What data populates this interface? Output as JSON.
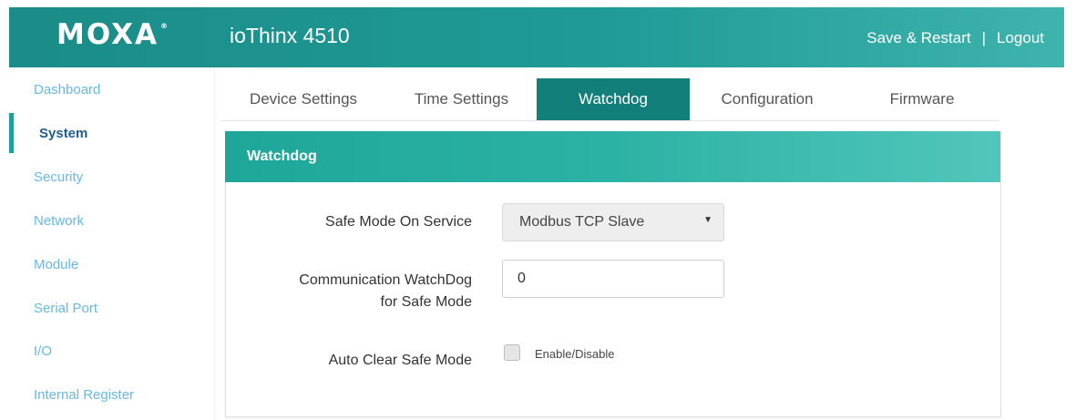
{
  "header": {
    "logo": "MOXA",
    "logo_mark": "®",
    "product": "ioThinx 4510",
    "save_restart": "Save & Restart",
    "separator": "|",
    "logout": "Logout"
  },
  "sidebar": {
    "items": [
      {
        "label": "Dashboard"
      },
      {
        "label": "System",
        "active": true
      },
      {
        "label": "Security"
      },
      {
        "label": "Network"
      },
      {
        "label": "Module"
      },
      {
        "label": "Serial Port"
      },
      {
        "label": "I/O"
      },
      {
        "label": "Internal Register"
      }
    ]
  },
  "tabs": [
    {
      "label": "Device Settings"
    },
    {
      "label": "Time Settings"
    },
    {
      "label": "Watchdog",
      "active": true
    },
    {
      "label": "Configuration"
    },
    {
      "label": "Firmware"
    }
  ],
  "panel": {
    "title": "Watchdog",
    "safe_mode_label": "Safe Mode On Service",
    "safe_mode_value": "Modbus TCP Slave",
    "comm_label_line1": "Communication WatchDog",
    "comm_label_line2": "for Safe Mode",
    "comm_value": "0",
    "auto_clear_label": "Auto Clear Safe Mode",
    "auto_clear_checkbox_label": "Enable/Disable",
    "auto_clear_checked": false
  },
  "colors": {
    "header": "#1f9a96",
    "active_tab": "#137f7b",
    "panel_header": "#2cb2a4",
    "sidebar_link": "#66b8e6",
    "sidebar_active": "#1f5f8d"
  }
}
